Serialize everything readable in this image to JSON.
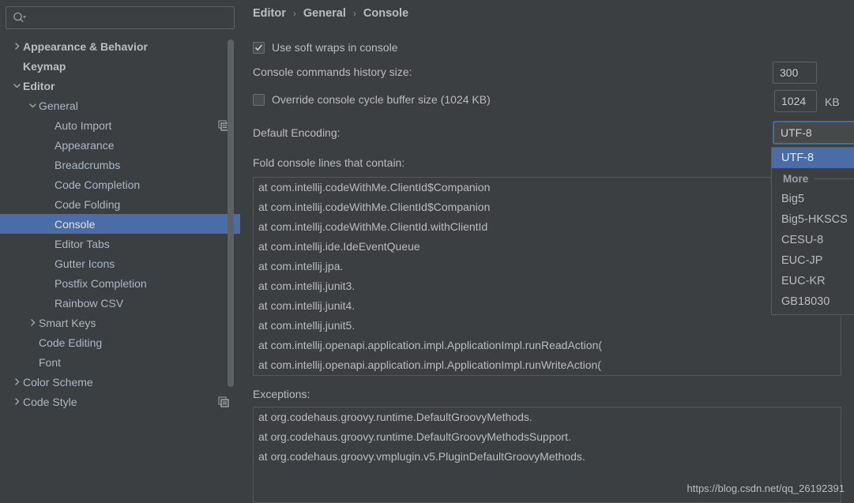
{
  "sidebar": {
    "search": {
      "placeholder": "",
      "value": ""
    },
    "items": [
      {
        "label": "Appearance & Behavior",
        "indent": 0,
        "twisty": "chevron-right",
        "bold": true,
        "selected": false,
        "icon": null
      },
      {
        "label": "Keymap",
        "indent": 0,
        "twisty": null,
        "bold": true,
        "selected": false,
        "icon": null
      },
      {
        "label": "Editor",
        "indent": 0,
        "twisty": "chevron-down",
        "bold": true,
        "selected": false,
        "icon": null
      },
      {
        "label": "General",
        "indent": 1,
        "twisty": "chevron-down",
        "bold": false,
        "selected": false,
        "icon": null
      },
      {
        "label": "Auto Import",
        "indent": 2,
        "twisty": null,
        "bold": false,
        "selected": false,
        "icon": "copy-icon"
      },
      {
        "label": "Appearance",
        "indent": 2,
        "twisty": null,
        "bold": false,
        "selected": false,
        "icon": null
      },
      {
        "label": "Breadcrumbs",
        "indent": 2,
        "twisty": null,
        "bold": false,
        "selected": false,
        "icon": null
      },
      {
        "label": "Code Completion",
        "indent": 2,
        "twisty": null,
        "bold": false,
        "selected": false,
        "icon": null
      },
      {
        "label": "Code Folding",
        "indent": 2,
        "twisty": null,
        "bold": false,
        "selected": false,
        "icon": null
      },
      {
        "label": "Console",
        "indent": 2,
        "twisty": null,
        "bold": false,
        "selected": true,
        "icon": null
      },
      {
        "label": "Editor Tabs",
        "indent": 2,
        "twisty": null,
        "bold": false,
        "selected": false,
        "icon": null
      },
      {
        "label": "Gutter Icons",
        "indent": 2,
        "twisty": null,
        "bold": false,
        "selected": false,
        "icon": null
      },
      {
        "label": "Postfix Completion",
        "indent": 2,
        "twisty": null,
        "bold": false,
        "selected": false,
        "icon": null
      },
      {
        "label": "Rainbow CSV",
        "indent": 2,
        "twisty": null,
        "bold": false,
        "selected": false,
        "icon": null
      },
      {
        "label": "Smart Keys",
        "indent": 1,
        "twisty": "chevron-right",
        "bold": false,
        "selected": false,
        "icon": null
      },
      {
        "label": "Code Editing",
        "indent": 1,
        "twisty": null,
        "bold": false,
        "selected": false,
        "icon": null
      },
      {
        "label": "Font",
        "indent": 1,
        "twisty": null,
        "bold": false,
        "selected": false,
        "icon": null
      },
      {
        "label": "Color Scheme",
        "indent": 0,
        "twisty": "chevron-right",
        "bold": false,
        "selected": false,
        "icon": null
      },
      {
        "label": "Code Style",
        "indent": 0,
        "twisty": "chevron-right",
        "bold": false,
        "selected": false,
        "icon": "copy-icon"
      }
    ]
  },
  "breadcrumb": {
    "items": [
      "Editor",
      "General",
      "Console"
    ],
    "separator": "›"
  },
  "settings": {
    "soft_wraps": {
      "label": "Use soft wraps in console",
      "checked": true
    },
    "history_size": {
      "label": "Console commands history size:",
      "value": "300"
    },
    "cycle_buffer": {
      "label": "Override console cycle buffer size (1024 KB)",
      "checked": false,
      "value": "1024",
      "unit": "KB"
    },
    "default_encoding": {
      "label": "Default Encoding:",
      "value": "UTF-8"
    },
    "fold_lines": {
      "label": "Fold console lines that contain:",
      "lines": [
        "at com.intellij.codeWithMe.ClientId$Companion",
        "at com.intellij.codeWithMe.ClientId$Companion",
        "at com.intellij.codeWithMe.ClientId.withClientId",
        "at com.intellij.ide.IdeEventQueue",
        "at com.intellij.jpa.",
        "at com.intellij.junit3.",
        "at com.intellij.junit4.",
        "at com.intellij.junit5.",
        "at com.intellij.openapi.application.impl.ApplicationImpl.runReadAction(",
        "at com.intellij.openapi.application.impl.ApplicationImpl.runWriteAction("
      ]
    },
    "exceptions": {
      "label": "Exceptions:",
      "lines": [
        "at org.codehaus.groovy.runtime.DefaultGroovyMethods.",
        "at org.codehaus.groovy.runtime.DefaultGroovyMethodsSupport.",
        "at org.codehaus.groovy.vmplugin.v5.PluginDefaultGroovyMethods."
      ]
    }
  },
  "encoding_dropdown": {
    "open": true,
    "selected": "UTF-8",
    "group_label": "More",
    "items": [
      "UTF-8",
      "Big5",
      "Big5-HKSCS",
      "CESU-8",
      "EUC-JP",
      "EUC-KR",
      "GB18030"
    ]
  },
  "watermark": "https://blog.csdn.net/qq_26192391",
  "colors": {
    "background": "#3c3f41",
    "selection": "#4a6da7",
    "focus_border": "#466d94",
    "text": "#bbbbbb"
  }
}
